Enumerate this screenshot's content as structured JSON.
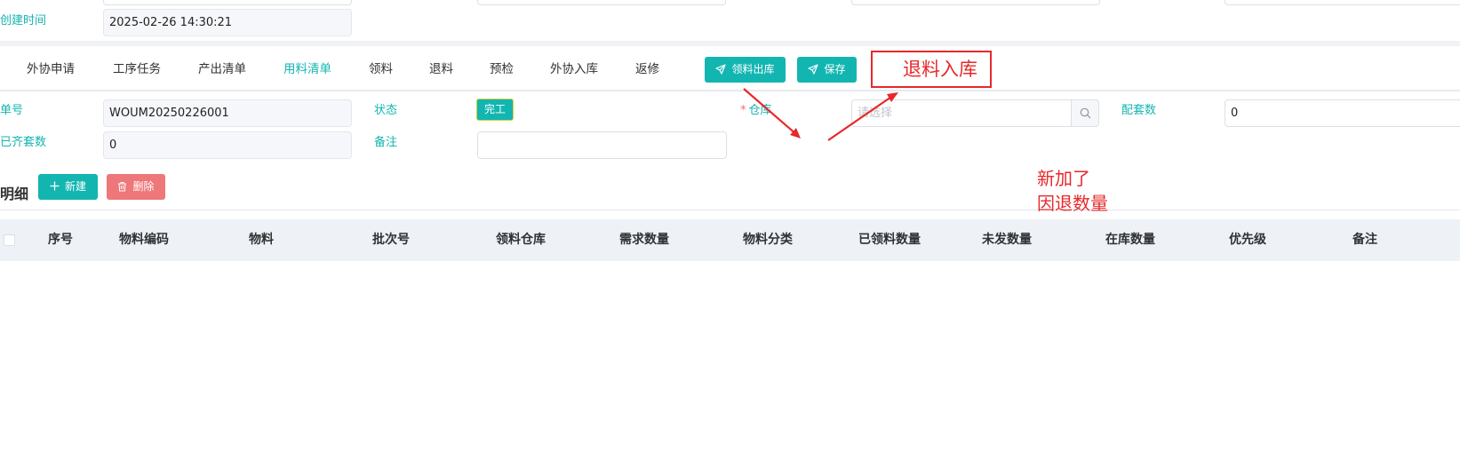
{
  "top_form": {
    "created_time_label": "创建时间",
    "created_time_value": "2025-02-26 14:30:21"
  },
  "tabs": [
    {
      "label": "外协申请",
      "active": false
    },
    {
      "label": "工序任务",
      "active": false
    },
    {
      "label": "产出清单",
      "active": false
    },
    {
      "label": "用料清单",
      "active": true
    },
    {
      "label": "领料",
      "active": false
    },
    {
      "label": "退料",
      "active": false
    },
    {
      "label": "预检",
      "active": false
    },
    {
      "label": "外协入库",
      "active": false
    },
    {
      "label": "返修",
      "active": false
    }
  ],
  "toolbar": {
    "issue_button": "领料出库",
    "save_button": "保存"
  },
  "annotations": {
    "box_text": "退料入库",
    "note_line1": "新加了",
    "note_line2": "因退数量",
    "color": "#e8282b"
  },
  "form": {
    "order_no_label": "单号",
    "order_no_value": "WOUM20250226001",
    "status_label": "状态",
    "status_value": "完工",
    "warehouse_label": "仓库",
    "warehouse_placeholder": "请选择",
    "set_count_label": "配套数",
    "set_count_value": "0",
    "complete_set_label": "已齐套数",
    "complete_set_value": "0",
    "remark_label": "备注",
    "remark_value": ""
  },
  "detail": {
    "title": "明细",
    "new_button": "新建",
    "delete_button": "删除",
    "columns": [
      "序号",
      "物料编码",
      "物料",
      "批次号",
      "领料仓库",
      "需求数量",
      "物料分类",
      "已领料数量",
      "未发数量",
      "在库数量",
      "优先级",
      "备注"
    ]
  },
  "colors": {
    "accent": "#13b5b1",
    "danger": "#ee7779"
  }
}
